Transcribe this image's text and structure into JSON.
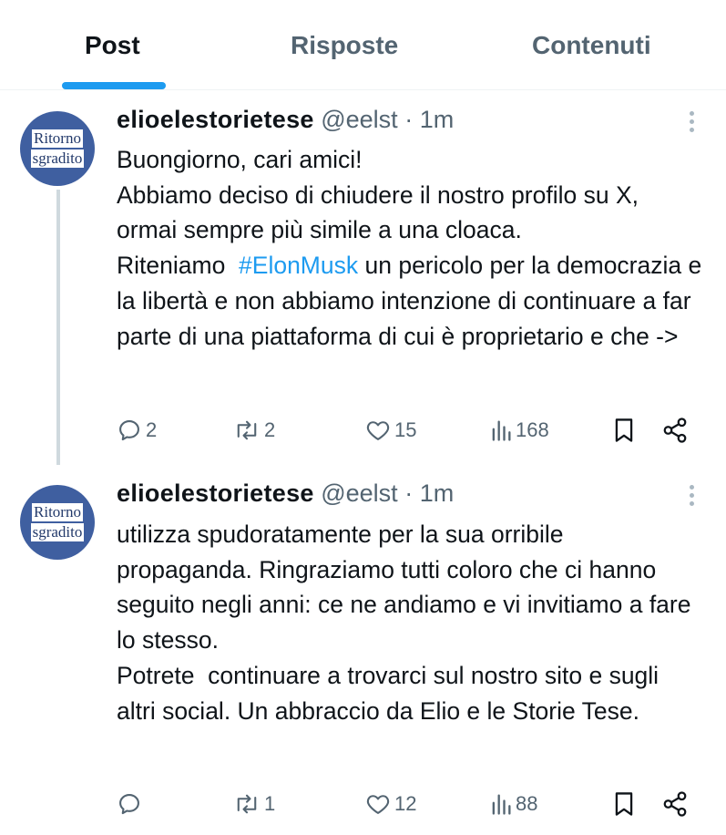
{
  "tabs": [
    {
      "label": "Post",
      "active": true
    },
    {
      "label": "Risposte",
      "active": false
    },
    {
      "label": "Contenuti",
      "active": false
    }
  ],
  "avatar": {
    "line1": "Ritorno",
    "line2": "sgradito"
  },
  "tweets": [
    {
      "author": "elioelestorietese",
      "handle": "@eelst",
      "dot": "·",
      "time": "1m",
      "text_before": "Buongiorno, cari amici!\nAbbiamo deciso di chiudere il nostro profilo su X, ormai sempre più simile a una cloaca.\nRiteniamo  ",
      "hashtag": "#ElonMusk",
      "text_after": " un pericolo per la democrazia e la libertà e non abbiamo intenzione di continuare a far parte di una piattaforma di cui è proprietario e che ->",
      "stats": {
        "replies": "2",
        "reposts": "2",
        "likes": "15",
        "views": "168"
      }
    },
    {
      "author": "elioelestorietese",
      "handle": "@eelst",
      "dot": "·",
      "time": "1m",
      "text": "utilizza spudoratamente per la sua orribile propaganda. Ringraziamo tutti coloro che ci hanno seguito negli anni: ce ne andiamo e vi invitiamo a fare lo stesso.\nPotrete  continuare a trovarci sul nostro sito e sugli altri social. Un abbraccio da Elio e le Storie Tese.",
      "stats": {
        "replies": "",
        "reposts": "1",
        "likes": "12",
        "views": "88"
      }
    }
  ],
  "colors": {
    "accent": "#1d9bf0",
    "muted": "#536471",
    "text": "#0f1419",
    "avatar_bg": "#3f5fa0"
  },
  "icons": [
    "reply-icon",
    "repost-icon",
    "like-icon",
    "views-icon",
    "bookmark-icon",
    "share-icon",
    "more-icon"
  ]
}
